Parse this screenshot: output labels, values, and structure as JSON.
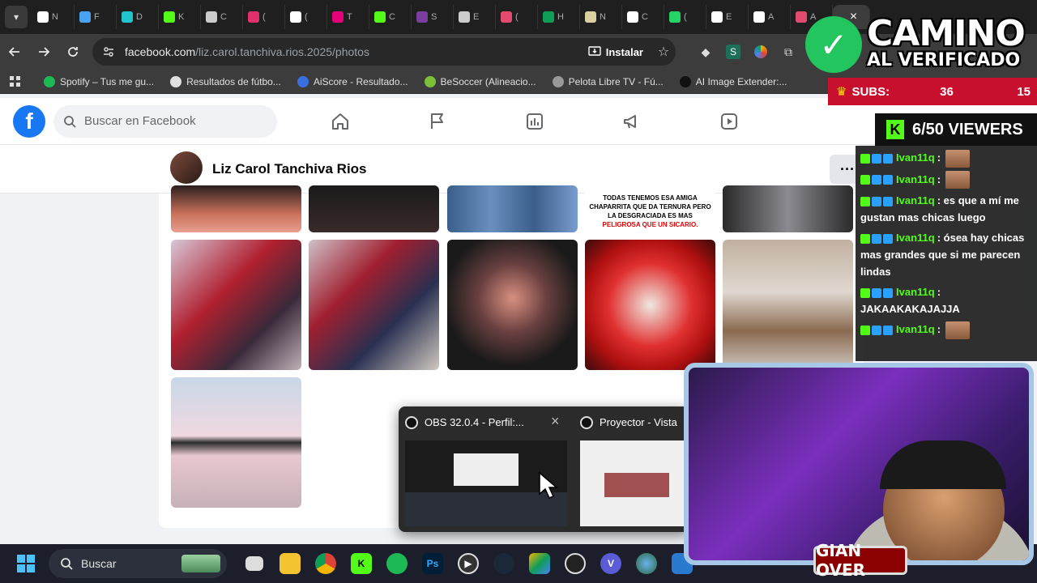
{
  "browser": {
    "tabs": [
      {
        "label": "N",
        "icon": "github-icon",
        "color": "#ffffff"
      },
      {
        "label": "F",
        "icon": "edge-icon",
        "color": "#4aa3f0"
      },
      {
        "label": "D",
        "icon": "canva-icon",
        "color": "#20c4cb"
      },
      {
        "label": "K",
        "icon": "kick-icon",
        "color": "#53fc18"
      },
      {
        "label": "C",
        "icon": "openai-icon",
        "color": "#cccccc"
      },
      {
        "label": "(",
        "icon": "instagram-icon",
        "color": "#e1306c"
      },
      {
        "label": "(",
        "icon": "tiktok-icon",
        "color": "#ffffff"
      },
      {
        "label": "T",
        "icon": "t-icon",
        "color": "#e6007a"
      },
      {
        "label": "C",
        "icon": "kick-icon",
        "color": "#53fc18"
      },
      {
        "label": "S",
        "icon": "s-icon",
        "color": "#7a3ea0"
      },
      {
        "label": "E",
        "icon": "e-icon",
        "color": "#cccccc"
      },
      {
        "label": "(",
        "icon": "flame-icon",
        "color": "#e34a6f"
      },
      {
        "label": "H",
        "icon": "plus-icon",
        "color": "#0f9d58"
      },
      {
        "label": "N",
        "icon": "n-icon",
        "color": "#d8d0a0"
      },
      {
        "label": "C",
        "icon": "c-icon",
        "color": "#ffffff"
      },
      {
        "label": "(",
        "icon": "whatsapp-icon",
        "color": "#25d366"
      },
      {
        "label": "E",
        "icon": "x-icon",
        "color": "#ffffff"
      },
      {
        "label": "A",
        "icon": "amazon-icon",
        "color": "#ffffff"
      },
      {
        "label": "A",
        "icon": "image-icon",
        "color": "#e34a6f"
      }
    ],
    "close_tab_label": "×",
    "url_site": "facebook.com",
    "url_path": "/liz.carol.tanchiva.rios.2025/photos",
    "install_label": "Instalar",
    "bookmarks": [
      {
        "label": "Spotify – Tus me gu...",
        "color": "#1db954"
      },
      {
        "label": "Resultados de fútbo...",
        "color": "#e0e0e0"
      },
      {
        "label": "AiScore - Resultado...",
        "color": "#3b6fe0"
      },
      {
        "label": "BeSoccer (Alineacio...",
        "color": "#7cbf3a"
      },
      {
        "label": "Pelota Libre TV - Fú...",
        "color": "#999999"
      },
      {
        "label": "AI Image Extender:...",
        "color": "#111111"
      }
    ]
  },
  "facebook": {
    "search_placeholder": "Buscar en Facebook",
    "profile_name": "Liz Carol Tanchiva Rios",
    "more_label": "···",
    "meme_caption_1": "TODAS TENEMOS ESA AMIGA CHAPARRITA QUE DA TERNURA PERO LA DESGRACIADA ES MAS",
    "meme_caption_2": "PELIGROSA QUE UN SICARIO."
  },
  "obs": {
    "item1_title": "OBS 32.0.4 - Perfil:...",
    "item2_title": "Proyector - Vista",
    "close_label": "×"
  },
  "taskbar": {
    "search_label": "Buscar",
    "apps": [
      "file-explorer-icon",
      "folder-icon",
      "chrome-icon",
      "kick-icon",
      "spotify-icon",
      "photoshop-icon",
      "media-player-icon",
      "steam-icon",
      "bluestacks-icon",
      "obs-icon",
      "v-icon",
      "earth-icon",
      "video-editor-icon"
    ],
    "ps_label": "Ps",
    "v_label": "V"
  },
  "stream_overlay": {
    "title_line1": "CAMINO",
    "title_line2": "AL VERIFICADO",
    "subs_label": "SUBS:",
    "subs_value": "36",
    "subs_goal": "15",
    "viewers_text": "6/50 VIEWERS",
    "chat": [
      {
        "user": "Ivan11q",
        "text": ":",
        "emote": true
      },
      {
        "user": "Ivan11q",
        "text": ":",
        "emote": true
      },
      {
        "user": "Ivan11q",
        "text": ": es que a mí me gustan mas chicas luego",
        "emote": false
      },
      {
        "user": "Ivan11q",
        "text": ": ósea hay chicas mas grandes que si me parecen lindas",
        "emote": false
      },
      {
        "user": "Ivan11q",
        "text": ": JAKAAKAKAJAJJA",
        "emote": false
      },
      {
        "user": "Ivan11q",
        "text": ":",
        "emote": true
      }
    ],
    "webcam_name": "GIAN OVER"
  },
  "colors": {
    "fb_blue": "#1877f2",
    "kick_green": "#53fc18",
    "subs_red": "#c8102e",
    "verified_green": "#22c55e"
  }
}
